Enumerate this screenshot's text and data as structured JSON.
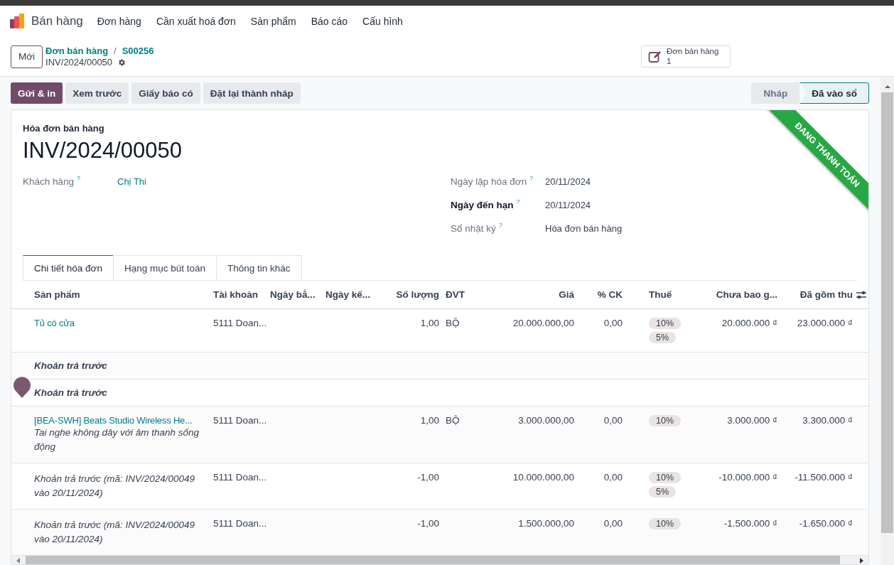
{
  "navbar": {
    "app_name": "Bán hàng",
    "menu": [
      "Đơn hàng",
      "Cần xuất hoá đơn",
      "Sản phẩm",
      "Báo cáo",
      "Cấu hình"
    ]
  },
  "control_panel": {
    "new_button": "Mới",
    "breadcrumbs": [
      "Đơn bán hàng",
      "S00256"
    ],
    "separator": "/",
    "record": "INV/2024/00050",
    "smart_button": {
      "label": "Đơn bán hàng",
      "count": "1"
    }
  },
  "actions": [
    {
      "label": "Gửi & in",
      "primary": true
    },
    {
      "label": "Xem trước",
      "primary": false
    },
    {
      "label": "Giấy báo có",
      "primary": false
    },
    {
      "label": "Đặt lại thành nháp",
      "primary": false
    }
  ],
  "status_bar": [
    {
      "label": "Nháp",
      "selected": false
    },
    {
      "label": "Đã vào sổ",
      "selected": true
    }
  ],
  "ribbon": "ĐANG THANH TOÁN",
  "sheet": {
    "subtitle": "Hóa đơn bán hàng",
    "title": "INV/2024/00050",
    "left_fields": [
      {
        "label": "Khách hàng",
        "help": "?",
        "value": "Chị Thi",
        "link": true,
        "required": false
      }
    ],
    "right_fields": [
      {
        "label": "Ngày lập hóa đơn",
        "help": "?",
        "value": "20/11/2024",
        "link": false,
        "required": false
      },
      {
        "label": "Ngày đến hạn",
        "help": "?",
        "value": "20/11/2024",
        "link": false,
        "required": true
      },
      {
        "label": "Sổ nhật ký",
        "help": "?",
        "value": "Hóa đơn bán hàng",
        "link": false,
        "required": false
      }
    ]
  },
  "tabs": [
    {
      "label": "Chi tiết hóa đơn",
      "selected": true
    },
    {
      "label": "Hạng mục bút toán",
      "selected": false
    },
    {
      "label": "Thông tin khác",
      "selected": false
    }
  ],
  "table": {
    "columns": [
      "Sản phẩm",
      "Tài khoản",
      "Ngày bắ...",
      "Ngày kế...",
      "Số lượng",
      "ĐVT",
      "Giá",
      "% CK",
      "Thuế",
      "Chưa bao g...",
      "Đã gồm thu"
    ],
    "rows": [
      {
        "kind": "product",
        "name": "Tủ có cửa",
        "account": "5111 Doan...",
        "quantity": "1,00",
        "uom": "BỘ",
        "price": "20.000.000,00",
        "discount": "0,00",
        "taxes": [
          "10%",
          "5%"
        ],
        "subtotal": "20.000.000 ₫",
        "total": "23.000.000 ₫"
      },
      {
        "kind": "section",
        "name": "Khoản trả trước"
      },
      {
        "kind": "section",
        "name": "Khoản trả trước"
      },
      {
        "kind": "product",
        "name": "[BEA-SWH] Beats Studio Wireless He...",
        "description": "Tai nghe không dây với âm thanh sống động",
        "account": "5111 Doan...",
        "quantity": "1,00",
        "uom": "BỘ",
        "price": "3.000.000,00",
        "discount": "0,00",
        "taxes": [
          "10%"
        ],
        "subtotal": "3.000.000 ₫",
        "total": "3.300.000 ₫"
      },
      {
        "kind": "downpayment",
        "name": "Khoản trả trước (mã: INV/2024/00049 vào 20/11/2024)",
        "account": "5111 Doan...",
        "quantity": "-1,00",
        "price": "10.000.000,00",
        "discount": "0,00",
        "taxes": [
          "10%",
          "5%"
        ],
        "subtotal": "-10.000.000 ₫",
        "total": "-11.500.000 ₫"
      },
      {
        "kind": "downpayment",
        "name": "Khoản trả trước (mã: INV/2024/00049 vào 20/11/2024)",
        "account": "5111 Doan...",
        "quantity": "-1,00",
        "price": "1.500.000,00",
        "discount": "0,00",
        "taxes": [
          "10%"
        ],
        "subtotal": "-1.500.000 ₫",
        "total": "-1.650.000 ₫"
      }
    ]
  }
}
